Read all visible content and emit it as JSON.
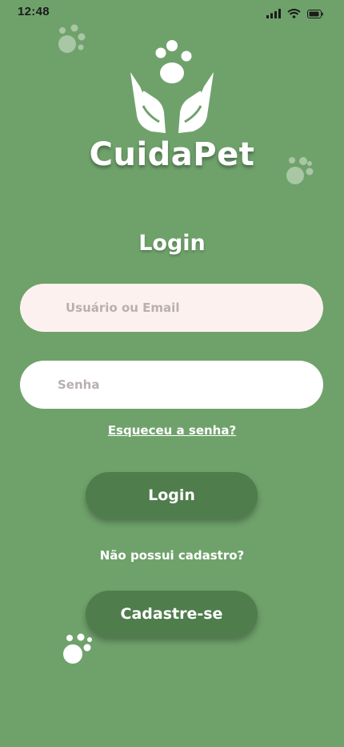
{
  "status_bar": {
    "time": "12:48",
    "icons": [
      "cellular-signal-icon",
      "wifi-icon",
      "battery-icon"
    ]
  },
  "brand": {
    "name": "CuidaPet",
    "logo_icon": "hands-holding-paw-icon"
  },
  "login": {
    "title": "Login",
    "username_placeholder": "Usuário ou Email",
    "password_placeholder": "Senha",
    "forgot_password": "Esqueceu a senha?",
    "login_button": "Login",
    "no_account_text": "Não possui cadastro?",
    "signup_button": "Cadastre-se"
  },
  "decorations": [
    "paw-print-icon",
    "paw-print-icon",
    "paw-print-icon"
  ],
  "colors": {
    "background": "#6fa26b",
    "button": "#4f7d4c",
    "input_user": "#fdf1f0",
    "input_pass": "#ffffff",
    "text": "#ffffff"
  }
}
